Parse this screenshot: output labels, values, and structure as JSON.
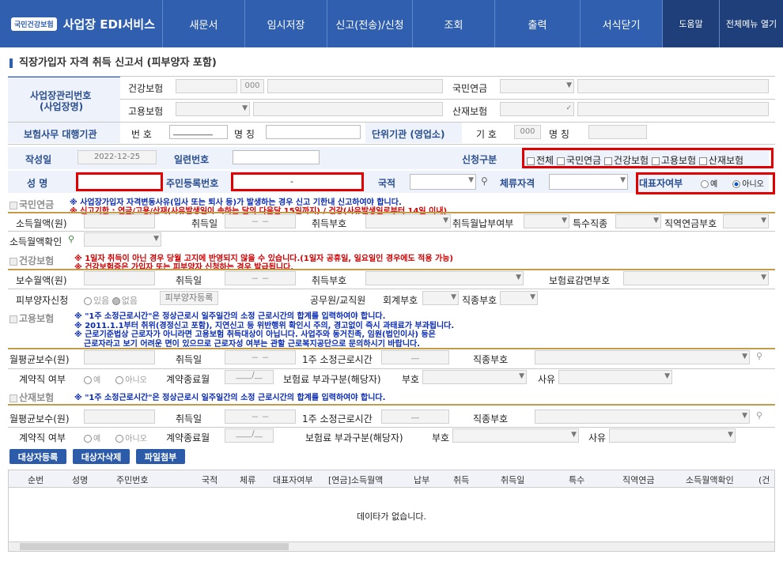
{
  "header": {
    "logo_badge": "국민건강보험",
    "app_title": "사업장 EDI서비스",
    "menu": [
      "새문서",
      "임시저장",
      "신고(전송)/신청",
      "조회",
      "출력",
      "서식닫기"
    ],
    "help": "도움말",
    "all_menu": "전체메뉴 열기"
  },
  "page_title": "직장가입자 자격 취득 신고서 (피부양자 포함)",
  "employer": {
    "label_line1": "사업장관리번호",
    "label_line2": "(사업장명)",
    "health_label": "건강보험",
    "health_suffix": "000",
    "pension_label": "국민연금",
    "employment_label": "고용보험",
    "accident_label": "산재보험",
    "agency_label": "보험사무 대행기관",
    "agency_no_label": "번 호",
    "agency_no_value": "__________",
    "agency_name_label": "명 칭",
    "unit_label": "단위기관 (영업소)",
    "unit_code_label": "기 호",
    "unit_code_value": "000",
    "unit_name_label": "명 칭"
  },
  "form": {
    "date_label": "작성일",
    "date_value": "2022-12-25",
    "serial_label": "일련번호",
    "apply_label": "신청구분",
    "apply_options": [
      "전체",
      "국민연금",
      "건강보험",
      "고용보험",
      "산재보험"
    ],
    "name_label": "성 명",
    "rrn_label": "주민등록번호",
    "rrn_sep": "-",
    "nation_label": "국적",
    "stay_label": "체류자격",
    "rep_label": "대표자여부",
    "rep_yes": "예",
    "rep_no": "아니오"
  },
  "pension": {
    "title": "국민연금",
    "notice1": "※ 사업장가입자 자격변동사유(입사 또는 퇴사 등)가 발생하는 경우 신고 기한내 신고하여야 합니다.",
    "notice2": "※ 신고기한 : 연금/고용/산재(사유발생일이 속하는 달의 다음달 15일까지) / 건강(사유발생일로부터 14일 이내)",
    "income_label": "소득월액(원)",
    "acq_date_label": "취득일",
    "date_placeholder": "－ －",
    "acq_code_label": "취득부호",
    "income_pay_label": "취득월납부여부",
    "special_label": "특수직종",
    "job_pension_label": "직역연금부호",
    "income_confirm_label": "소득월액확인"
  },
  "health": {
    "title": "건강보험",
    "notice1": "※ 1일자 취득이 아닌 경우 당월 고지에 반영되지 않을 수 있습니다.(1일자 공휴일, 일요일인 경우에도 적용 가능)",
    "notice2": "※ 건강보험증은 가입자 또는 피부양자 신청하는 경우 발급됩니다.",
    "salary_label": "보수월액(원)",
    "acq_date_label": "취득일",
    "acq_code_label": "취득부호",
    "reduce_label": "보험료감면부호",
    "dependent_label": "피부양자신청",
    "dep_yes": "있음",
    "dep_no": "없음",
    "dep_register": "피부양자등록",
    "official_label": "공무원/교직원",
    "account_label": "회계부호",
    "jobcode_label": "직종부호"
  },
  "employment": {
    "title": "고용보험",
    "notice1": "※ \"1주 소정근로시간\"은 정상근로시 일주일간의 소정 근로시간의 합계를 입력하여야 합니다.",
    "notice2": "※ 2011.1.1부터 취위(경정신고 포함), 지연신고 등 위반행위 확인시 주의, 경고없이 즉시 과태료가 부과됩니다.",
    "notice3": "※ 근로기준법상 근로자가 아니라면 고용보험 취득대상이 아닙니다. 사업주와 동거친족, 임원(법인이사) 등은",
    "notice4": "근로자라고 보기 어려운 면이 있으므로 근로자성 여부는 관할 근로복지공단으로 문의하시기 바랍니다.",
    "avg_salary_label": "월평균보수(원)",
    "acq_date_label": "취득일",
    "weekly_hours_label": "1주 소정근로시간",
    "hours_placeholder": "__",
    "jobcode_label": "직종부호",
    "contract_label": "계약직 여부",
    "yes": "예",
    "no": "아니오",
    "contract_end_label": "계약종료월",
    "month_placeholder": "____/__",
    "levy_label": "보험료 부과구분(해당자)",
    "code_label": "부호",
    "reason_label": "사유"
  },
  "accident": {
    "title": "산재보험",
    "notice1": "※ \"1주 소정근로시간\"은 정상근로시 일주일간의 소정 근로시간의 합계를 입력하여야 합니다.",
    "avg_salary_label": "월평균보수(원)",
    "acq_date_label": "취득일",
    "weekly_hours_label": "1주 소정근로시간",
    "jobcode_label": "직종부호",
    "contract_label": "계약직 여부",
    "contract_end_label": "계약종료월",
    "levy_label": "보험료 부과구분(해당자)",
    "code_label": "부호",
    "reason_label": "사유"
  },
  "buttons": {
    "register": "대상자등록",
    "delete": "대상자삭제",
    "attach": "파일첨부"
  },
  "grid": {
    "columns": [
      "순번",
      "성명",
      "주민번호",
      "국적",
      "체류",
      "대표자여부",
      "[연금]소득월액",
      "납부",
      "취득",
      "취득일",
      "특수",
      "직역연금",
      "소득월액확인",
      "(건"
    ],
    "empty": "데이타가 없습니다."
  }
}
